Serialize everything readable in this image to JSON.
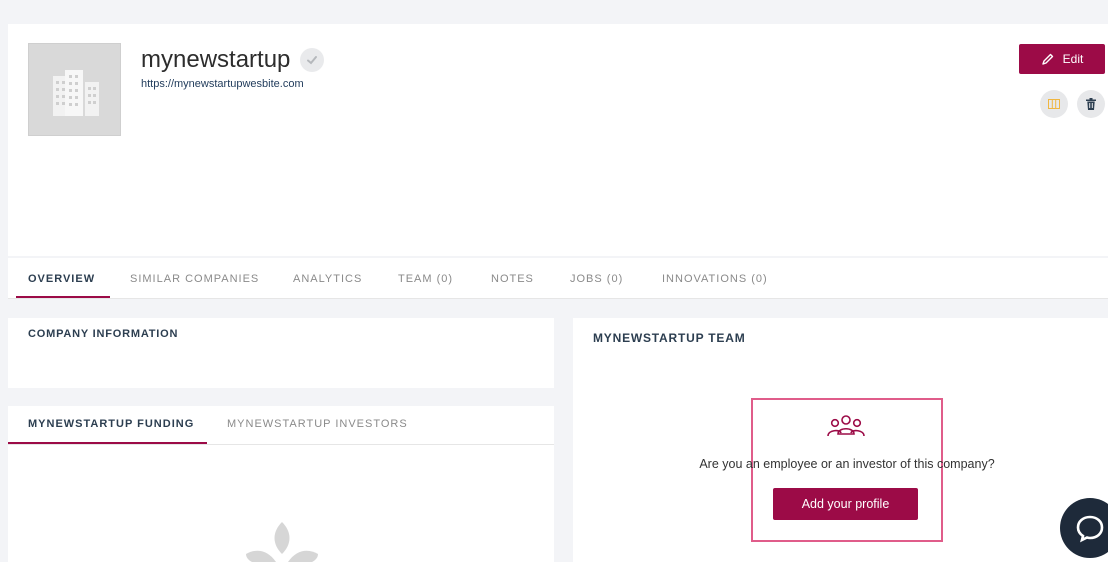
{
  "company": {
    "name": "mynewstartup",
    "url": "https://mynewstartupwesbite.com"
  },
  "actions": {
    "edit_label": "Edit"
  },
  "tabs": [
    {
      "label": "OVERVIEW"
    },
    {
      "label": "SIMILAR COMPANIES"
    },
    {
      "label": "ANALYTICS"
    },
    {
      "label": "TEAM (0)"
    },
    {
      "label": "NOTES"
    },
    {
      "label": "JOBS (0)"
    },
    {
      "label": "INNOVATIONS (0)"
    }
  ],
  "company_info": {
    "title": "COMPANY INFORMATION"
  },
  "funding": {
    "tabs": [
      {
        "label": "MYNEWSTARTUP FUNDING"
      },
      {
        "label": "MYNEWSTARTUP INVESTORS"
      }
    ]
  },
  "team": {
    "title": "MYNEWSTARTUP TEAM",
    "question": "Are you an employee or an investor of this company?",
    "add_profile_label": "Add your profile"
  },
  "colors": {
    "brand": "#9c0b47",
    "highlight": "#e05c8a",
    "chat": "#1e2a3a"
  },
  "icons": {
    "logo": "building-icon",
    "verified": "check-icon",
    "edit": "pencil-icon",
    "compare": "columns-icon",
    "delete": "trash-icon",
    "team": "people-group-icon",
    "chat": "chat-bubble-icon",
    "placeholder": "leaf-logo-icon"
  }
}
